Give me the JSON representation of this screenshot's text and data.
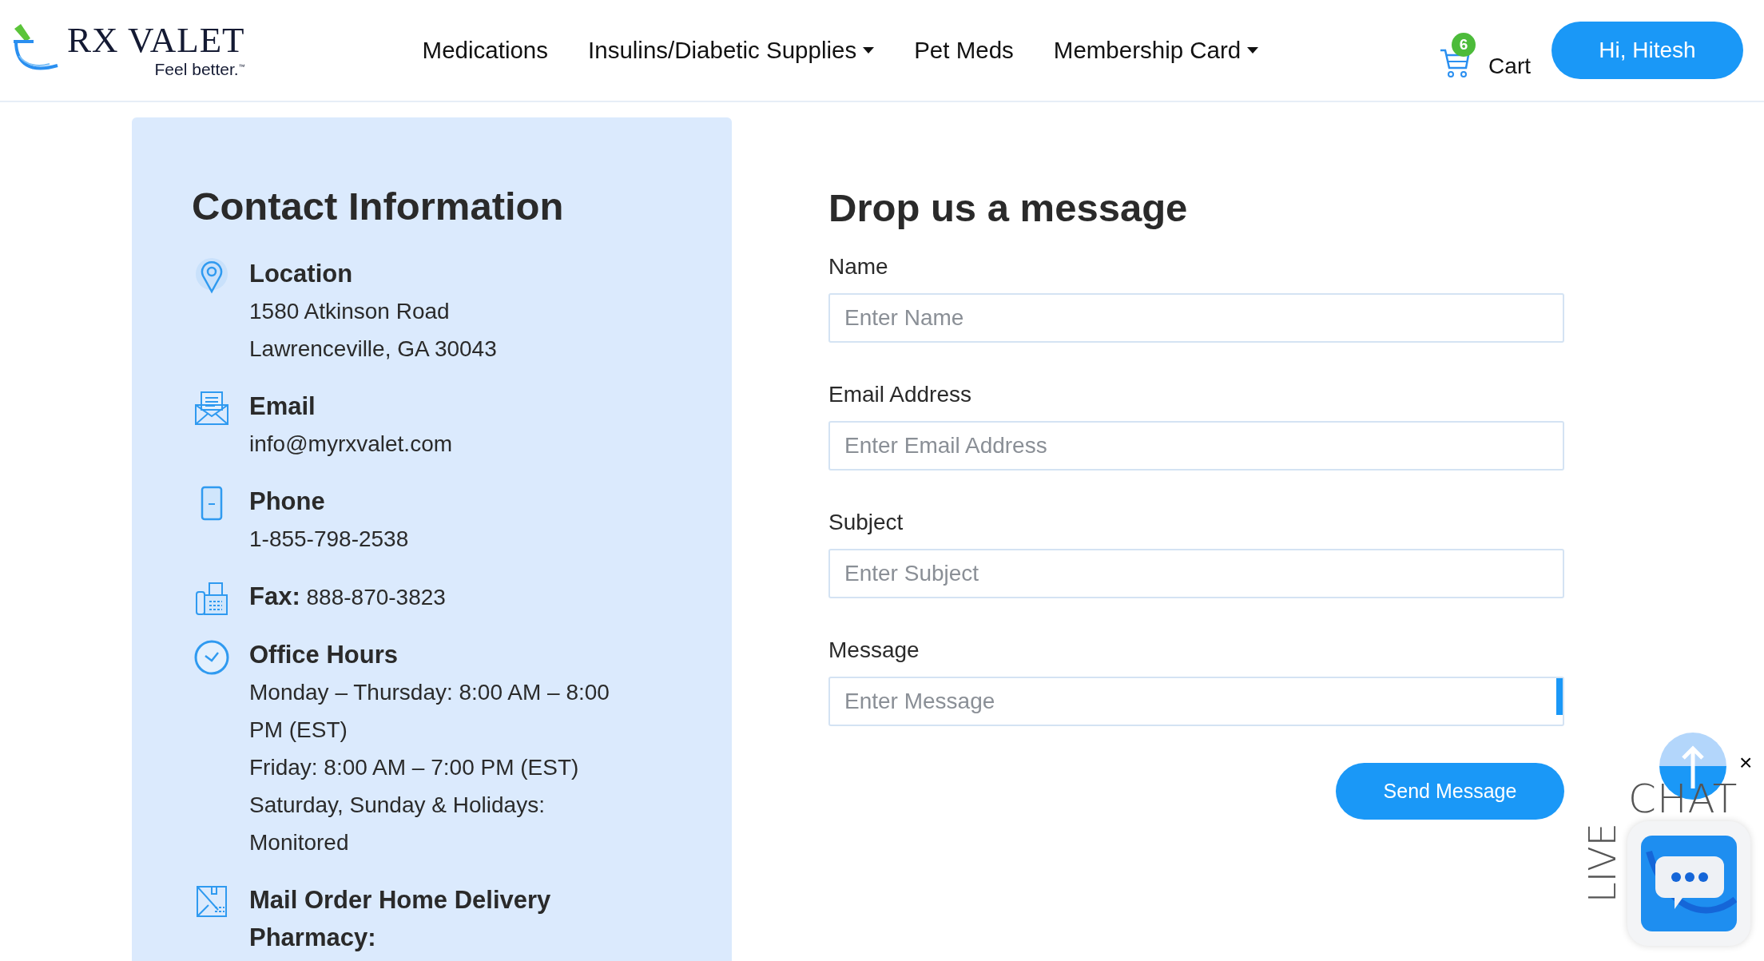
{
  "header": {
    "logo": {
      "wordmark": "RX VALET",
      "tagline": "Feel better.$^{™}$"
    },
    "nav": [
      {
        "label": "Medications",
        "has_menu": false
      },
      {
        "label": "Insulins/Diabetic Supplies",
        "has_menu": true
      },
      {
        "label": "Pet Meds",
        "has_menu": false
      },
      {
        "label": "Membership Card",
        "has_menu": true
      }
    ],
    "cart": {
      "label": "Cart",
      "count": "6"
    },
    "account_button": "Hi, Hitesh"
  },
  "contact": {
    "title": "Contact Information",
    "items": [
      {
        "kind": "location",
        "title": "Location",
        "lines": [
          "1580 Atkinson Road",
          "Lawrenceville, GA 30043"
        ]
      },
      {
        "kind": "email",
        "title": "Email",
        "lines": [
          "info@myrxvalet.com"
        ]
      },
      {
        "kind": "phone",
        "title": "Phone",
        "lines": [
          "1-855-798-2538"
        ]
      },
      {
        "kind": "fax",
        "text": "**Fax:** 888-870-3823"
      },
      {
        "kind": "hours",
        "title": "Office Hours",
        "lines": [
          "Monday – Thursday: 8:00 AM – 8:00 PM (EST)",
          "Friday: 8:00 AM – 7:00 PM (EST)",
          "Saturday, Sunday & Holidays: Monitored"
        ]
      },
      {
        "kind": "delivery",
        "title": "Mail Order Home Delivery Pharmacy:"
      }
    ]
  },
  "form": {
    "title": "Drop us a message",
    "fields": [
      {
        "label": "Name",
        "placeholder": "Enter Name"
      },
      {
        "label": "Email Address",
        "placeholder": "Enter Email Address"
      },
      {
        "label": "Subject",
        "placeholder": "Enter Subject"
      },
      {
        "label": "Message",
        "placeholder": "Enter Message"
      }
    ],
    "submit": "Send Message"
  },
  "chat_widget": {
    "top_label": "CHAT",
    "side_label": "LIVE",
    "close": "×"
  }
}
